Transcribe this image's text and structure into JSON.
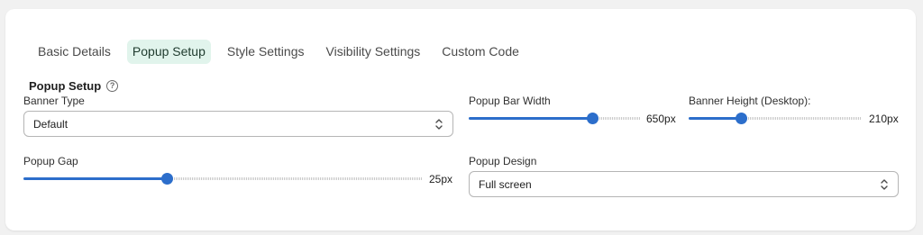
{
  "tabs": [
    {
      "label": "Basic Details",
      "active": false
    },
    {
      "label": "Popup Setup",
      "active": true
    },
    {
      "label": "Style Settings",
      "active": false
    },
    {
      "label": "Visibility Settings",
      "active": false
    },
    {
      "label": "Custom Code",
      "active": false
    }
  ],
  "section": {
    "title": "Popup Setup",
    "help_icon": "question-circle-icon"
  },
  "banner_type": {
    "label": "Banner Type",
    "value": "Default"
  },
  "popup_bar_width": {
    "label": "Popup Bar Width",
    "value_text": "650px",
    "fraction": 0.72
  },
  "banner_height": {
    "label": "Banner Height (Desktop):",
    "value_text": "210px",
    "fraction": 0.3
  },
  "popup_gap": {
    "label": "Popup Gap",
    "value_text": "25px",
    "fraction": 0.36
  },
  "popup_design": {
    "label": "Popup Design",
    "value": "Full screen"
  },
  "colors": {
    "accent": "#2c6ecb",
    "active_tab_bg": "#e1f4ec"
  }
}
